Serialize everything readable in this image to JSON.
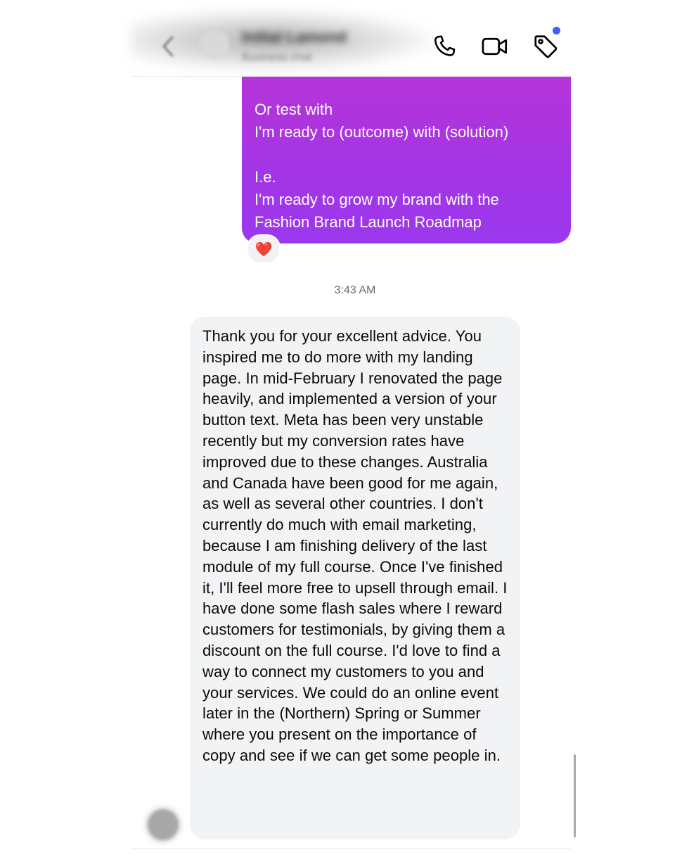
{
  "header": {
    "contact_name": "Initial Lamond",
    "contact_subtitle": "Business chat",
    "icons": {
      "back": "chevron-left-icon",
      "phone": "phone-icon",
      "video": "video-camera-icon",
      "tag": "tag-icon"
    },
    "accent_color": "#3f5efb"
  },
  "messages": {
    "sent": {
      "text": "Or test with\nI'm ready to (outcome) with (solution)\n\nI.e.\nI'm ready to grow my brand with the\nFashion Brand Launch Roadmap",
      "reaction": "❤️",
      "bubble_color": "#a335e6"
    },
    "timestamp": "3:43 AM",
    "received": {
      "text": "Thank you for your excellent advice. You inspired me to do more with my landing page. In mid-February I renovated the page heavily, and implemented a version of your button text. Meta has been very unstable recently but my conversion rates have improved due to these changes. Australia and Canada have been good for me again, as well as several other countries. I don't currently do much with email marketing, because I am finishing delivery of the last module of my full course. Once I've finished it, I'll feel more free to upsell through email. I have done some flash sales where I reward customers for testimonials, by giving them a discount on the full course. I'd love to find a way to connect my customers to you and your services. We could do an online event later in the (Northern) Spring or Summer where you present on the importance of copy and see if we can get some people in.",
      "bubble_color": "#f2f3f5"
    }
  }
}
